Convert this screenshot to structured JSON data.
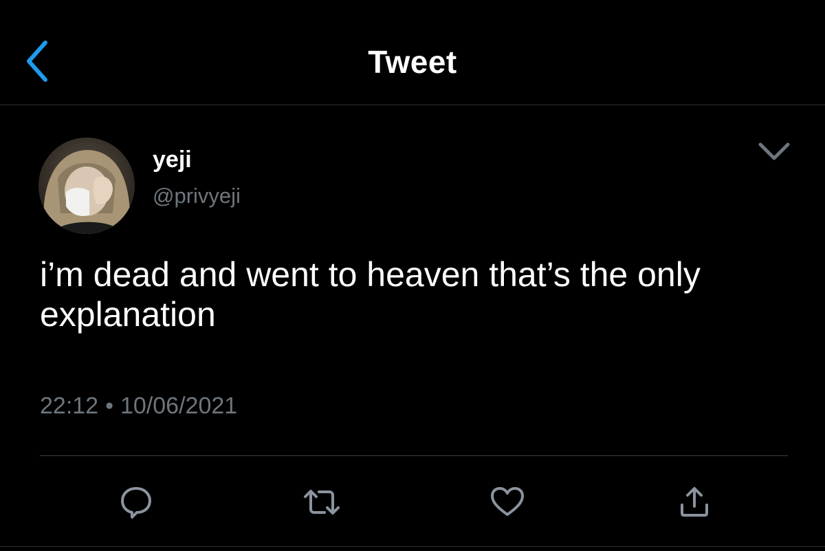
{
  "header": {
    "title": "Tweet",
    "back_icon": "chevron-left-icon"
  },
  "tweet": {
    "author": {
      "display_name": "yeji",
      "handle": "@privyeji"
    },
    "text": "i’m dead and went to heaven that’s the only explanation",
    "time": "22:12",
    "separator": "•",
    "date": "10/06/2021"
  },
  "actions": [
    {
      "name": "reply",
      "icon": "reply-bubble-icon"
    },
    {
      "name": "retweet",
      "icon": "retweet-icon"
    },
    {
      "name": "like",
      "icon": "heart-icon"
    },
    {
      "name": "share",
      "icon": "share-icon"
    }
  ],
  "colors": {
    "background": "#000000",
    "text": "#ffffff",
    "secondary_text": "#6e767d",
    "accent": "#1d9bf0",
    "divider": "#2f3336"
  }
}
